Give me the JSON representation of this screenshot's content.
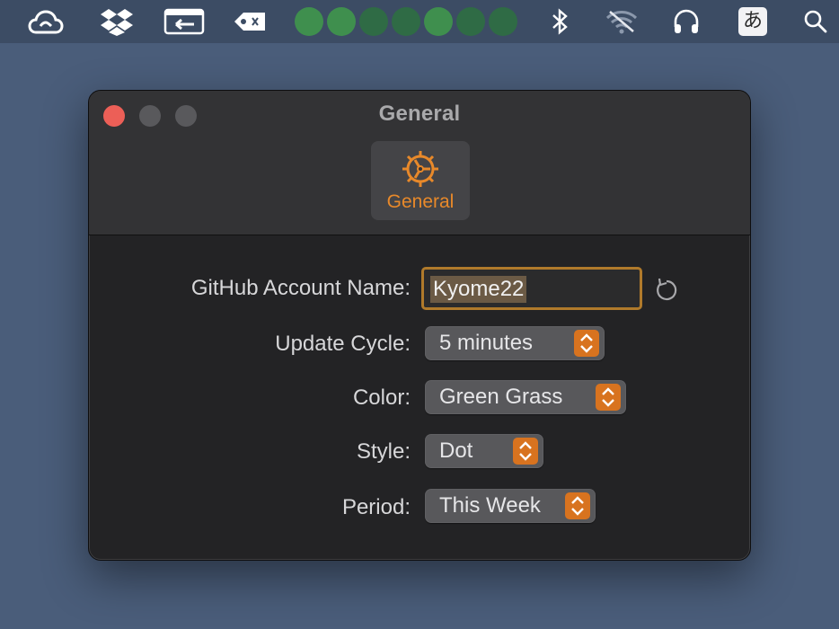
{
  "menubar": {
    "status_dots": [
      {
        "color": "#3f8f4e"
      },
      {
        "color": "#3f8f4e"
      },
      {
        "color": "#2f6b45"
      },
      {
        "color": "#2f6b45"
      },
      {
        "color": "#3f8f4e"
      },
      {
        "color": "#2f6b45"
      },
      {
        "color": "#2f6b45"
      }
    ],
    "input_method_label": "あ",
    "icons": [
      "creative-cloud-icon",
      "dropbox-icon",
      "screen-share-icon",
      "tag-icon",
      "bluetooth-icon",
      "wifi-off-icon",
      "headphones-icon",
      "input-method-icon",
      "search-icon"
    ]
  },
  "window": {
    "title": "General",
    "toolbar": {
      "tabs": [
        {
          "label": "General",
          "icon": "gear-icon"
        }
      ]
    },
    "form": {
      "github_account": {
        "label": "GitHub Account Name:",
        "value": "Kyome22"
      },
      "update_cycle": {
        "label": "Update Cycle:",
        "value": "5 minutes"
      },
      "color": {
        "label": "Color:",
        "value": "Green Grass"
      },
      "style": {
        "label": "Style:",
        "value": "Dot"
      },
      "period": {
        "label": "Period:",
        "value": "This Week"
      }
    }
  },
  "colors": {
    "accent": "#e8892a",
    "close": "#ec5f57",
    "desktop": "#4a5d7a"
  }
}
